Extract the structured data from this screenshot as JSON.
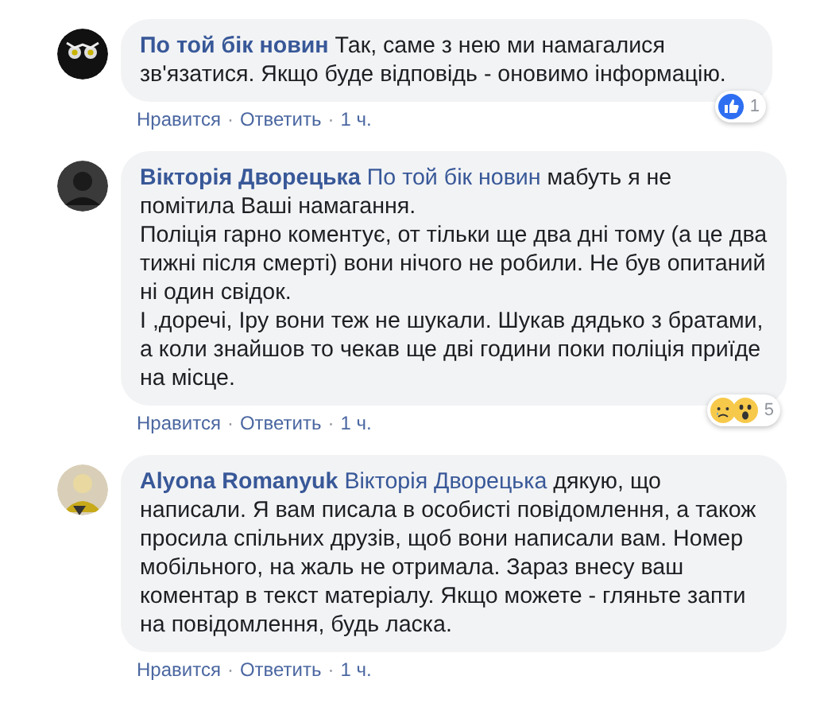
{
  "comments": [
    {
      "author": "По той бік новин",
      "avatar": {
        "kind": "owl"
      },
      "text": "Так, саме з нею ми намагалися зв'язатися. Якщо буде відповідь - оновимо інформацію.",
      "actions": [
        {
          "kind": "link",
          "label": "Нравится"
        },
        {
          "kind": "separator",
          "label": "·"
        },
        {
          "kind": "link",
          "label": "Ответить"
        },
        {
          "kind": "separator",
          "label": "·"
        },
        {
          "kind": "time",
          "label": "1 ч."
        }
      ],
      "reactions": {
        "icons": [
          {
            "kind": "like"
          }
        ],
        "count": "1"
      }
    },
    {
      "author": "Вікторія Дворецька",
      "avatar": {
        "kind": "dark"
      },
      "mention": "По той бік новин",
      "text": "мабуть я не помітила Ваші намагання.\nПоліція гарно коментує, от тільки ще два дні тому (а це два тижні після смерті) вони нічого не робили. Не був опитаний ні один свідок.\nІ ,доречі, Іру вони теж не шукали. Шукав дядько з братами, а коли знайшов то чекав ще дві години поки поліція приїде на місце.",
      "actions": [
        {
          "kind": "link",
          "label": "Нравится"
        },
        {
          "kind": "separator",
          "label": "·"
        },
        {
          "kind": "link",
          "label": "Ответить"
        },
        {
          "kind": "separator",
          "label": "·"
        },
        {
          "kind": "time",
          "label": "1 ч."
        }
      ],
      "reactions": {
        "icons": [
          {
            "kind": "sad"
          },
          {
            "kind": "wow"
          }
        ],
        "count": "5"
      }
    },
    {
      "author": "Alyona Romanyuk",
      "avatar": {
        "kind": "light"
      },
      "mention": "Вікторія Дворецька",
      "text": "дякую, що написали. Я вам писала в особисті повідомлення, а також просила спільних друзів, щоб вони написали вам. Номер мобільного, на жаль не отримала. Зараз внесу ваш коментар в текст матеріалу. Якщо можете - гляньте запти на повідомлення, будь ласка.",
      "actions": [
        {
          "kind": "link",
          "label": "Нравится"
        },
        {
          "kind": "separator",
          "label": "·"
        },
        {
          "kind": "link",
          "label": "Ответить"
        },
        {
          "kind": "separator",
          "label": "·"
        },
        {
          "kind": "time",
          "label": "1 ч."
        }
      ]
    }
  ]
}
